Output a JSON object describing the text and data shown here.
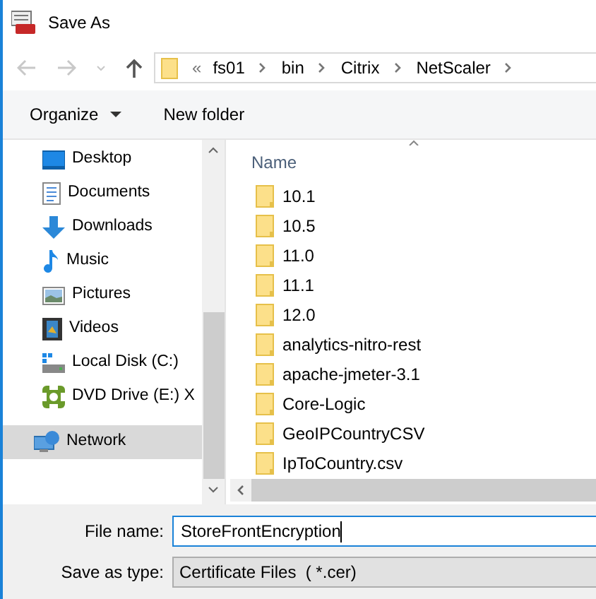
{
  "window": {
    "title": "Save As"
  },
  "address": {
    "overflow": "«",
    "path": [
      "fs01",
      "bin",
      "Citrix",
      "NetScaler"
    ]
  },
  "toolbar": {
    "organize": "Organize",
    "new_folder": "New folder"
  },
  "sidebar": {
    "items": [
      {
        "label": "Desktop",
        "kind": "desktop",
        "selected": false
      },
      {
        "label": "Documents",
        "kind": "documents",
        "selected": false
      },
      {
        "label": "Downloads",
        "kind": "downloads",
        "selected": false
      },
      {
        "label": "Music",
        "kind": "music",
        "selected": false
      },
      {
        "label": "Pictures",
        "kind": "pictures",
        "selected": false
      },
      {
        "label": "Videos",
        "kind": "videos",
        "selected": false
      },
      {
        "label": "Local Disk (C:)",
        "kind": "disk",
        "selected": false
      },
      {
        "label": "DVD Drive (E:) X",
        "kind": "dvd",
        "selected": false
      },
      {
        "label": "Network",
        "kind": "network",
        "selected": true
      }
    ]
  },
  "files": {
    "column": "Name",
    "items": [
      "10.1",
      "10.5",
      "11.0",
      "11.1",
      "12.0",
      "analytics-nitro-rest",
      "apache-jmeter-3.1",
      "Core-Logic",
      "GeoIPCountryCSV",
      "IpToCountry.csv"
    ]
  },
  "form": {
    "file_name_label": "File name:",
    "file_name": "StoreFrontEncryption",
    "type_label": "Save as type:",
    "type": "Certificate Files  ( *.cer)"
  }
}
